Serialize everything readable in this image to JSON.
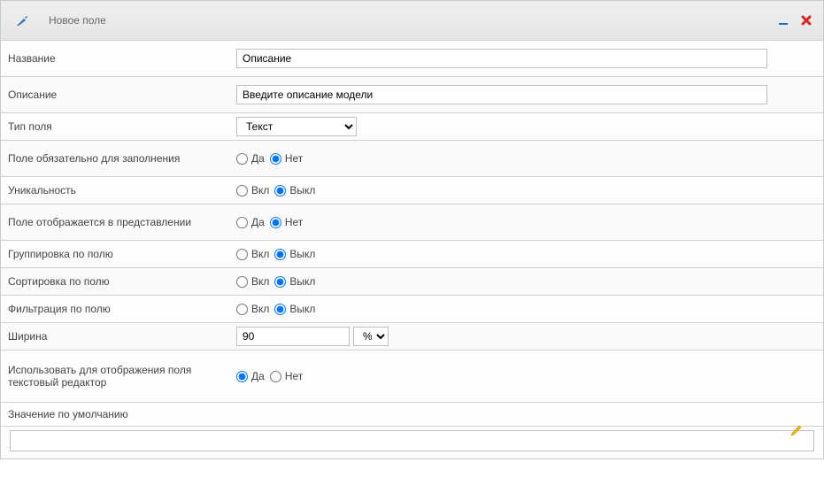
{
  "window": {
    "title": "Новое поле"
  },
  "fields": {
    "name": {
      "label": "Название",
      "value": "Описание"
    },
    "description": {
      "label": "Описание",
      "value": "Введите описание модели"
    },
    "field_type": {
      "label": "Тип поля",
      "value": "Текст"
    },
    "required": {
      "label": "Поле обязательно для заполнения",
      "yes": "Да",
      "no": "Нет",
      "selected": "no"
    },
    "uniqueness": {
      "label": "Уникальность",
      "on": "Вкл",
      "off": "Выкл",
      "selected": "off"
    },
    "show_in_view": {
      "label": "Поле отображается в представлении",
      "yes": "Да",
      "no": "Нет",
      "selected": "no"
    },
    "group_by": {
      "label": "Группировка по полю",
      "on": "Вкл",
      "off": "Выкл",
      "selected": "off"
    },
    "sort_by": {
      "label": "Сортировка по полю",
      "on": "Вкл",
      "off": "Выкл",
      "selected": "off"
    },
    "filter_by": {
      "label": "Фильтрация по полю",
      "on": "Вкл",
      "off": "Выкл",
      "selected": "off"
    },
    "width": {
      "label": "Ширина",
      "value": "90",
      "unit": "%"
    },
    "use_wysiwyg": {
      "label": "Использовать для отображения поля текстовый редактор",
      "yes": "Да",
      "no": "Нет",
      "selected": "yes"
    },
    "default_value": {
      "label": "Значение по умолчанию",
      "value": ""
    }
  }
}
